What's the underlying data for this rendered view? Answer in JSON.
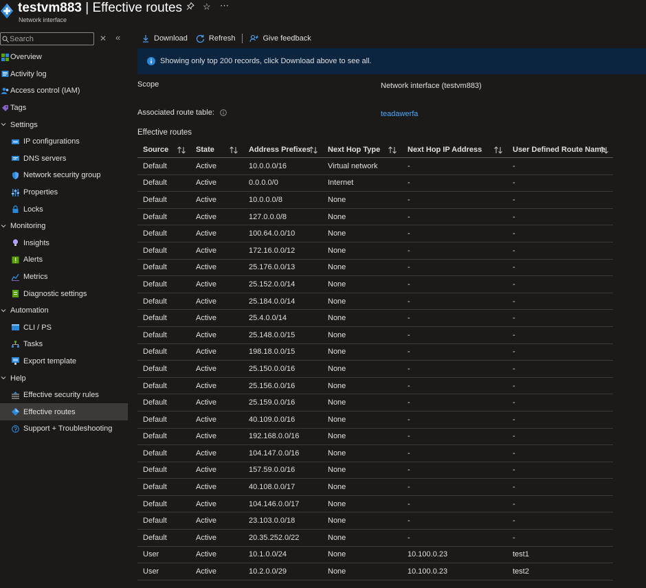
{
  "header": {
    "name": "testvm883",
    "title_rest": " | Effective routes",
    "subtitle": "Network interface"
  },
  "sidebar": {
    "search_placeholder": "Search",
    "items": [
      {
        "label": "Overview",
        "kind": "top",
        "icon": "overview-icon"
      },
      {
        "label": "Activity log",
        "kind": "top",
        "icon": "activity-log-icon"
      },
      {
        "label": "Access control (IAM)",
        "kind": "top",
        "icon": "iam-icon"
      },
      {
        "label": "Tags",
        "kind": "top",
        "icon": "tag-icon"
      },
      {
        "label": "Settings",
        "kind": "group"
      },
      {
        "label": "IP configurations",
        "kind": "child",
        "icon": "ip-config-icon"
      },
      {
        "label": "DNS servers",
        "kind": "child",
        "icon": "dns-icon"
      },
      {
        "label": "Network security group",
        "kind": "child",
        "icon": "shield-icon"
      },
      {
        "label": "Properties",
        "kind": "child",
        "icon": "properties-icon"
      },
      {
        "label": "Locks",
        "kind": "child",
        "icon": "lock-icon"
      },
      {
        "label": "Monitoring",
        "kind": "group"
      },
      {
        "label": "Insights",
        "kind": "child",
        "icon": "lightbulb-icon"
      },
      {
        "label": "Alerts",
        "kind": "child",
        "icon": "alert-icon"
      },
      {
        "label": "Metrics",
        "kind": "child",
        "icon": "metrics-icon"
      },
      {
        "label": "Diagnostic settings",
        "kind": "child",
        "icon": "diagnostic-icon"
      },
      {
        "label": "Automation",
        "kind": "group"
      },
      {
        "label": "CLI / PS",
        "kind": "child",
        "icon": "cli-icon"
      },
      {
        "label": "Tasks",
        "kind": "child",
        "icon": "tasks-icon"
      },
      {
        "label": "Export template",
        "kind": "child",
        "icon": "export-template-icon"
      },
      {
        "label": "Help",
        "kind": "group"
      },
      {
        "label": "Effective security rules",
        "kind": "child",
        "icon": "security-rules-icon"
      },
      {
        "label": "Effective routes",
        "kind": "child",
        "icon": "route-icon",
        "active": true
      },
      {
        "label": "Support + Troubleshooting",
        "kind": "child",
        "icon": "support-icon"
      }
    ]
  },
  "toolbar": {
    "download": "Download",
    "refresh": "Refresh",
    "feedback": "Give feedback"
  },
  "banner": {
    "text": "Showing only top 200 records, click Download above to see all."
  },
  "details": {
    "scope_label": "Scope",
    "scope_value": "Network interface (testvm883)",
    "route_table_label": "Associated route table:",
    "route_table_value": "teadawerfa",
    "section_title": "Effective routes"
  },
  "table": {
    "columns": [
      "Source",
      "State",
      "Address Prefixes",
      "Next Hop Type",
      "Next Hop IP Address",
      "User Defined Route Name"
    ],
    "rows": [
      [
        "Default",
        "Active",
        "10.0.0.0/16",
        "Virtual network",
        "-",
        "-"
      ],
      [
        "Default",
        "Active",
        "0.0.0.0/0",
        "Internet",
        "-",
        "-"
      ],
      [
        "Default",
        "Active",
        "10.0.0.0/8",
        "None",
        "-",
        "-"
      ],
      [
        "Default",
        "Active",
        "127.0.0.0/8",
        "None",
        "-",
        "-"
      ],
      [
        "Default",
        "Active",
        "100.64.0.0/10",
        "None",
        "-",
        "-"
      ],
      [
        "Default",
        "Active",
        "172.16.0.0/12",
        "None",
        "-",
        "-"
      ],
      [
        "Default",
        "Active",
        "25.176.0.0/13",
        "None",
        "-",
        "-"
      ],
      [
        "Default",
        "Active",
        "25.152.0.0/14",
        "None",
        "-",
        "-"
      ],
      [
        "Default",
        "Active",
        "25.184.0.0/14",
        "None",
        "-",
        "-"
      ],
      [
        "Default",
        "Active",
        "25.4.0.0/14",
        "None",
        "-",
        "-"
      ],
      [
        "Default",
        "Active",
        "25.148.0.0/15",
        "None",
        "-",
        "-"
      ],
      [
        "Default",
        "Active",
        "198.18.0.0/15",
        "None",
        "-",
        "-"
      ],
      [
        "Default",
        "Active",
        "25.150.0.0/16",
        "None",
        "-",
        "-"
      ],
      [
        "Default",
        "Active",
        "25.156.0.0/16",
        "None",
        "-",
        "-"
      ],
      [
        "Default",
        "Active",
        "25.159.0.0/16",
        "None",
        "-",
        "-"
      ],
      [
        "Default",
        "Active",
        "40.109.0.0/16",
        "None",
        "-",
        "-"
      ],
      [
        "Default",
        "Active",
        "192.168.0.0/16",
        "None",
        "-",
        "-"
      ],
      [
        "Default",
        "Active",
        "104.147.0.0/16",
        "None",
        "-",
        "-"
      ],
      [
        "Default",
        "Active",
        "157.59.0.0/16",
        "None",
        "-",
        "-"
      ],
      [
        "Default",
        "Active",
        "40.108.0.0/17",
        "None",
        "-",
        "-"
      ],
      [
        "Default",
        "Active",
        "104.146.0.0/17",
        "None",
        "-",
        "-"
      ],
      [
        "Default",
        "Active",
        "23.103.0.0/18",
        "None",
        "-",
        "-"
      ],
      [
        "Default",
        "Active",
        "20.35.252.0/22",
        "None",
        "-",
        "-"
      ],
      [
        "User",
        "Active",
        "10.1.0.0/24",
        "None",
        "10.100.0.23",
        "test1"
      ],
      [
        "User",
        "Active",
        "10.2.0.0/29",
        "None",
        "10.100.0.23",
        "test2"
      ]
    ]
  },
  "colors": {
    "background": "#1b1a19",
    "banner": "#0b2440",
    "link": "#4aa8ff",
    "active_nav": "#3b3a39",
    "accent_blue": "#0078d4"
  }
}
